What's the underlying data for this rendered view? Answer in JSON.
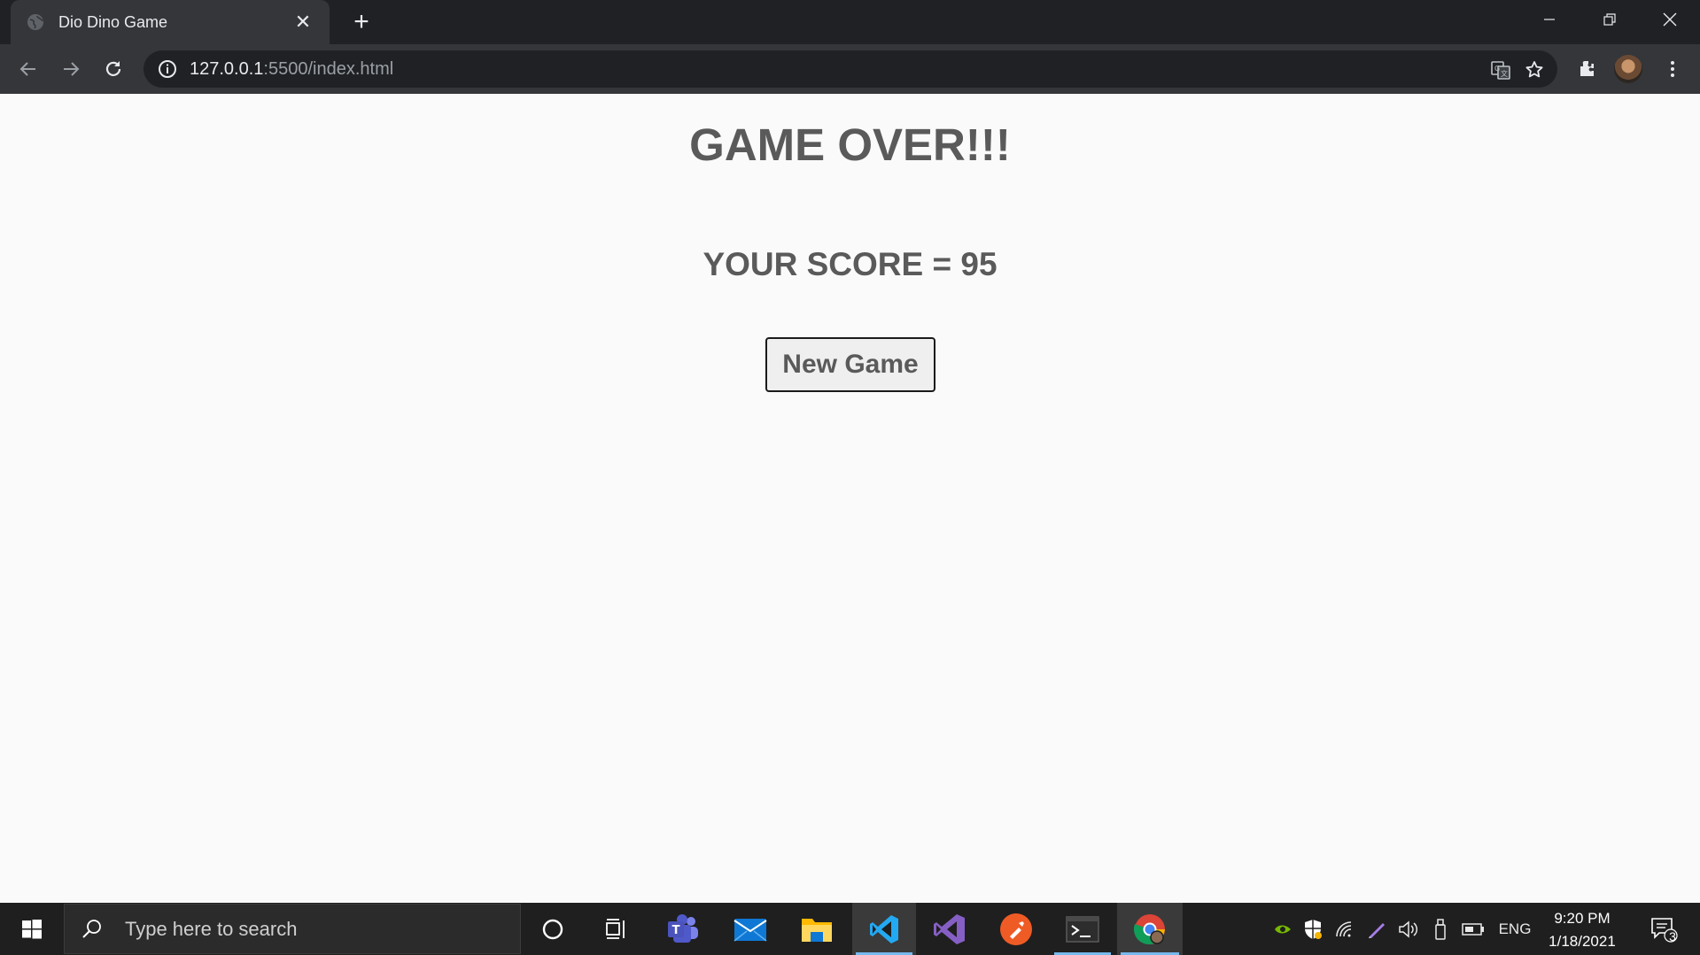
{
  "browser": {
    "tab_title": "Dio Dino Game",
    "tab_close": "✕",
    "new_tab": "+",
    "url_host": "127.0.0.1",
    "url_rest": ":5500/index.html"
  },
  "page": {
    "heading": "GAME OVER!!!",
    "score_text": "YOUR SCORE = 95",
    "new_game_label": "New Game"
  },
  "taskbar": {
    "search_placeholder": "Type here to search",
    "language": "ENG",
    "time": "9:20 PM",
    "date": "1/18/2021",
    "notification_count": "3"
  },
  "icons": {
    "accent": "#76b9ed",
    "text_color": "#5a5a5a"
  }
}
